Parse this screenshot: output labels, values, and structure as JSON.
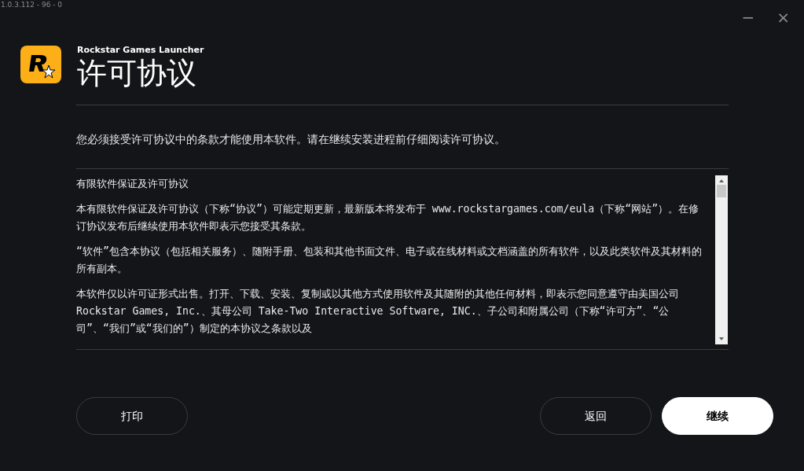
{
  "version": "1.0.3.112 - 96 - 0",
  "window_controls": {
    "minimize": "−",
    "close": "×"
  },
  "header": {
    "app_name": "Rockstar Games Launcher",
    "title": "许可协议"
  },
  "intro": "您必须接受许可协议中的条款才能使用本软件。请在继续安装进程前仔细阅读许可协议。",
  "agreement": {
    "heading": "有限软件保证及许可协议",
    "paragraphs": [
      "本有限软件保证及许可协议（下称“协议”）可能定期更新，最新版本将发布于 www.rockstargames.com/eula（下称“网站”）。在修订协议发布后继续使用本软件即表示您接受其条款。",
      "“软件”包含本协议（包括相关服务）、随附手册、包装和其他书面文件、电子或在线材料或文档涵盖的所有软件，以及此类软件及其材料的所有副本。",
      "本软件仅以许可证形式出售。打开、下载、安装、复制或以其他方式使用软件及其随附的其他任何材料，即表示您同意遵守由美国公司 Rockstar Games, Inc.、其母公司 Take-Two Interactive Software, INC.、子公司和附属公司（下称“许可方”、“公司”、“我们”或“我们的”）制定的本协议之条款以及"
    ]
  },
  "buttons": [
    {
      "label": "打印",
      "kind": "outline"
    },
    {
      "label": "返回",
      "kind": "outline"
    },
    {
      "label": "继续",
      "kind": "primary"
    }
  ]
}
